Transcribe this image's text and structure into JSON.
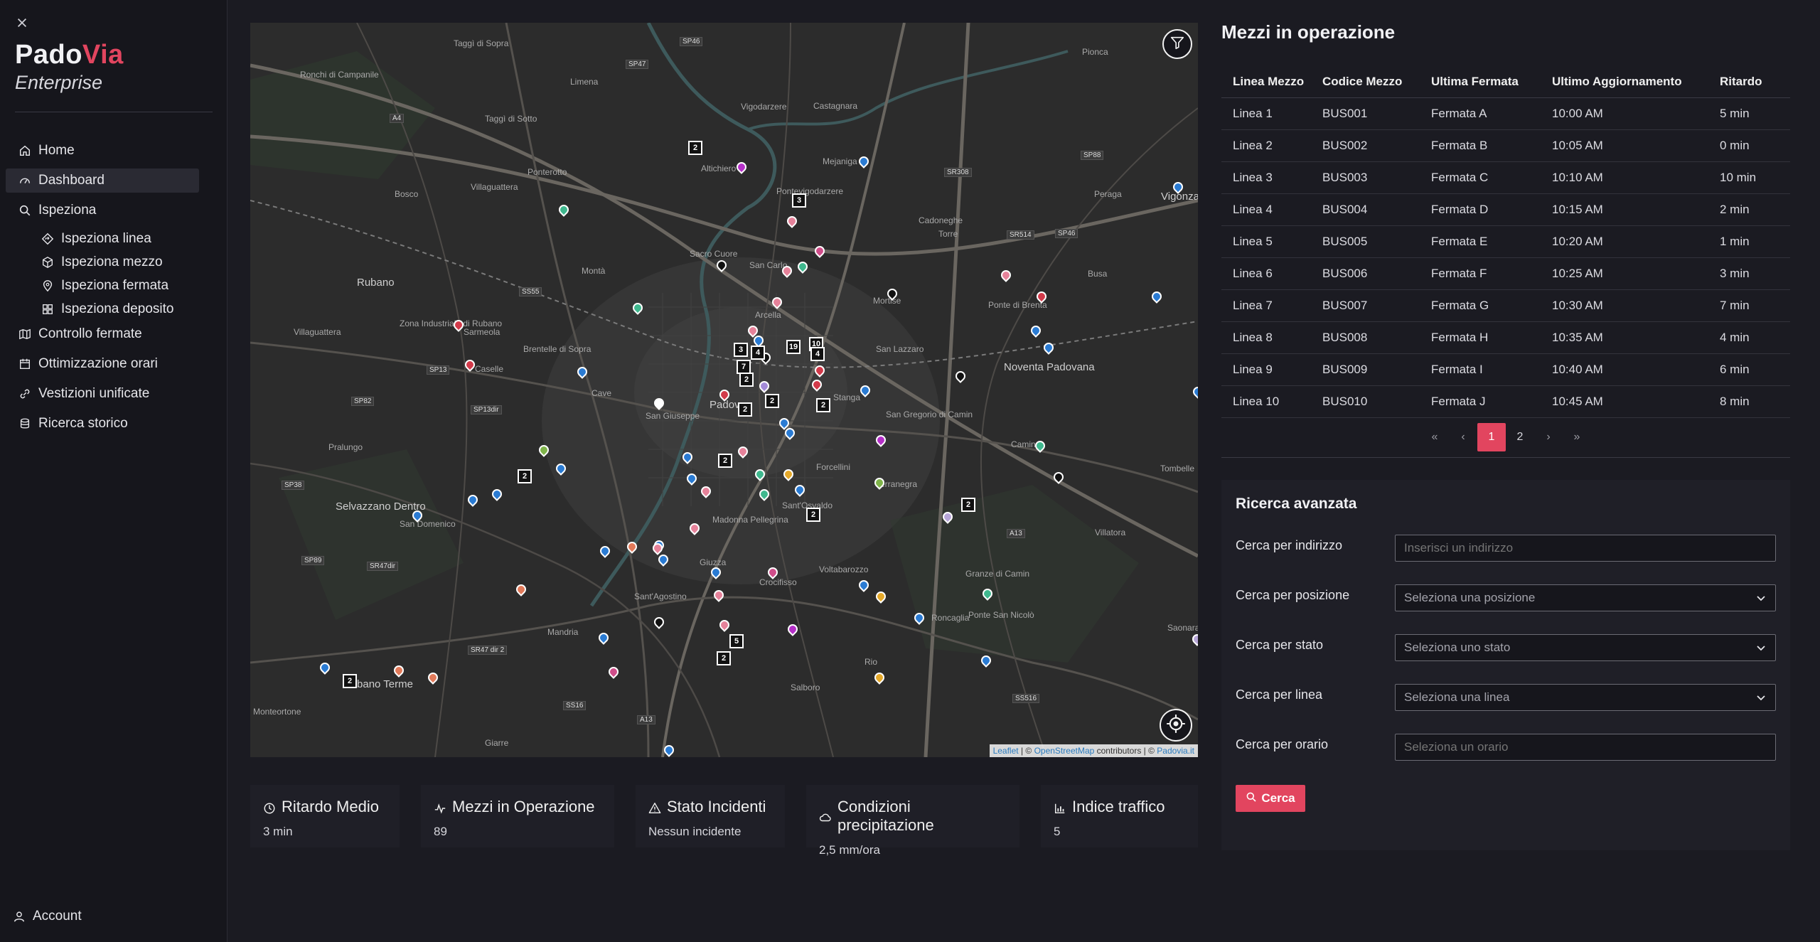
{
  "brand": {
    "name_part1": "Pado",
    "name_part2": "Via",
    "subtitle": "Enterprise"
  },
  "sidebar": {
    "items": [
      {
        "label": "Home",
        "icon": "home-icon"
      },
      {
        "label": "Dashboard",
        "icon": "dashboard-icon",
        "active": true
      },
      {
        "label": "Ispeziona",
        "icon": "search-icon"
      },
      {
        "label": "Ispeziona linea",
        "icon": "diamond-route-icon",
        "sub": true
      },
      {
        "label": "Ispeziona mezzo",
        "icon": "cube-icon",
        "sub": true
      },
      {
        "label": "Ispeziona fermata",
        "icon": "map-pin-icon",
        "sub": true
      },
      {
        "label": "Ispeziona deposito",
        "icon": "grid-icon",
        "sub": true
      },
      {
        "label": "Controllo fermate",
        "icon": "map-icon"
      },
      {
        "label": "Ottimizzazione orari",
        "icon": "calendar-icon"
      },
      {
        "label": "Vestizioni unificate",
        "icon": "link-icon"
      },
      {
        "label": "Ricerca storico",
        "icon": "database-icon"
      }
    ],
    "account_label": "Account"
  },
  "map": {
    "attribution": {
      "leaflet": "Leaflet",
      "sep1": " | © ",
      "osm": "OpenStreetMap",
      "contrib": " contributors | © ",
      "padovia": "Padovia.it"
    },
    "places": [
      "Taggì di Sopra",
      "Ronchi di Campanile",
      "Limena",
      "Vigodarzere",
      "Castagnara",
      "Pionca",
      "Taggì di Sotto",
      "Altichiero",
      "Ponterotto",
      "Villaguattera",
      "Bosco",
      "Pontevigodarzere",
      "Mejaniga",
      "Torre",
      "Cadoneghe",
      "Peraga",
      "Vigonza",
      "Sacro Cuore",
      "Montà",
      "Rubano",
      "San Carlo",
      "Arcella",
      "Busa",
      "Mortise",
      "Ponte di Brenta",
      "Sarmeola",
      "Zona Industriale di Rubano",
      "Villaguattera",
      "Caselle",
      "Brentelle di Sopra",
      "San Lazzaro",
      "Noventa Padovana",
      "Cave",
      "Padova",
      "San Giuseppe",
      "Stanga",
      "San Gregorio di Camin",
      "Pralungo",
      "Forcellini",
      "Camin",
      "Tombelle",
      "Selvazzano Dentro",
      "San Domenico",
      "Terranegra",
      "Villatora",
      "Madonna Pellegrina",
      "Sant'Osvaldo",
      "Giuzza",
      "Voltabarozzo",
      "Crocifisso",
      "Granze di Camin",
      "Sant'Agostino",
      "Mandria",
      "Roncaglia",
      "Ponte San Nicolò",
      "Abano Terme",
      "Rio",
      "Salboro",
      "Monteortone",
      "Giarre",
      "Saonara"
    ],
    "roads": [
      "SP46",
      "SP47",
      "A4",
      "SR308",
      "SP88",
      "SR514",
      "SP46",
      "SS55",
      "SP13",
      "SP82",
      "SP13dir",
      "SP38",
      "SR47dir",
      "SP89",
      "SR47 dir 2",
      "SS16",
      "A13",
      "SS516",
      "A13"
    ],
    "clusters": [
      "2",
      "3",
      "3",
      "4",
      "19",
      "10",
      "4",
      "7",
      "2",
      "2",
      "2",
      "2",
      "2",
      "2",
      "2",
      "2",
      "2",
      "5",
      "2"
    ]
  },
  "stats": [
    {
      "title": "Ritardo Medio",
      "value": "3 min",
      "icon": "clock-icon"
    },
    {
      "title": "Mezzi in Operazione",
      "value": "89",
      "icon": "activity-icon"
    },
    {
      "title": "Stato Incidenti",
      "value": "Nessun incidente",
      "icon": "warning-icon"
    },
    {
      "title": "Condizioni precipitazione",
      "value": "2,5 mm/ora",
      "icon": "cloud-icon"
    },
    {
      "title": "Indice traffico",
      "value": "5",
      "icon": "bar-chart-icon"
    }
  ],
  "table": {
    "title": "Mezzi in operazione",
    "columns": [
      "Linea Mezzo",
      "Codice Mezzo",
      "Ultima Fermata",
      "Ultimo Aggiornamento",
      "Ritardo"
    ],
    "rows": [
      [
        "Linea 1",
        "BUS001",
        "Fermata A",
        "10:00 AM",
        "5 min"
      ],
      [
        "Linea 2",
        "BUS002",
        "Fermata B",
        "10:05 AM",
        "0 min"
      ],
      [
        "Linea 3",
        "BUS003",
        "Fermata C",
        "10:10 AM",
        "10 min"
      ],
      [
        "Linea 4",
        "BUS004",
        "Fermata D",
        "10:15 AM",
        "2 min"
      ],
      [
        "Linea 5",
        "BUS005",
        "Fermata E",
        "10:20 AM",
        "1 min"
      ],
      [
        "Linea 6",
        "BUS006",
        "Fermata F",
        "10:25 AM",
        "3 min"
      ],
      [
        "Linea 7",
        "BUS007",
        "Fermata G",
        "10:30 AM",
        "7 min"
      ],
      [
        "Linea 8",
        "BUS008",
        "Fermata H",
        "10:35 AM",
        "4 min"
      ],
      [
        "Linea 9",
        "BUS009",
        "Fermata I",
        "10:40 AM",
        "6 min"
      ],
      [
        "Linea 10",
        "BUS010",
        "Fermata J",
        "10:45 AM",
        "8 min"
      ]
    ],
    "pagination": {
      "first": "«",
      "prev": "‹",
      "pages": [
        "1",
        "2"
      ],
      "current": "1",
      "next": "›",
      "last": "»"
    }
  },
  "search": {
    "title": "Ricerca avanzata",
    "fields": [
      {
        "label": "Cerca per indirizzo",
        "placeholder": "Inserisci un indirizzo",
        "type": "input"
      },
      {
        "label": "Cerca per posizione",
        "placeholder": "Seleziona una posizione",
        "type": "select"
      },
      {
        "label": "Cerca per stato",
        "placeholder": "Seleziona uno stato",
        "type": "select"
      },
      {
        "label": "Cerca per linea",
        "placeholder": "Seleziona una linea",
        "type": "select"
      },
      {
        "label": "Cerca per orario",
        "placeholder": "Seleziona un orario",
        "type": "input"
      }
    ],
    "button_label": "Cerca"
  },
  "colors": {
    "accent": "#e2455f",
    "background": "#1b1b22",
    "sidebar": "#16161c",
    "card": "#1f1f27"
  }
}
